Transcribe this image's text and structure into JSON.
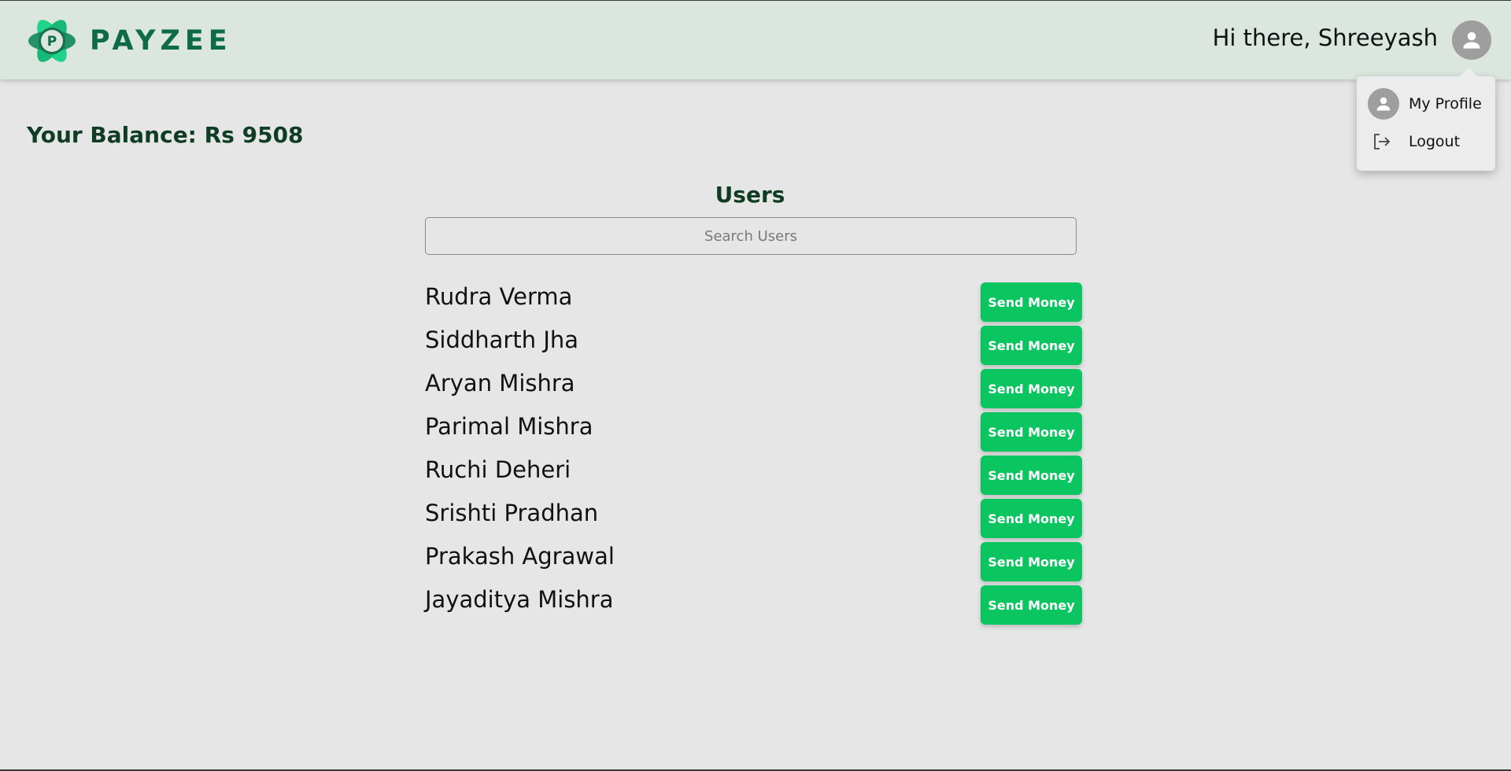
{
  "header": {
    "brand": "PAYZEE",
    "logo_letter": "P",
    "greeting": "Hi there, Shreeyash",
    "accent_color": "#0e6b4a"
  },
  "profile_menu": {
    "items": [
      {
        "label": "My Profile",
        "icon": "user-avatar-icon"
      },
      {
        "label": "Logout",
        "icon": "logout-icon"
      }
    ]
  },
  "balance": {
    "text": "Your Balance: Rs 9508"
  },
  "users": {
    "title": "Users",
    "search_placeholder": "Search Users",
    "send_button_color": "#0bc660",
    "list": [
      {
        "name": "Rudra Verma",
        "action": "Send Money"
      },
      {
        "name": "Siddharth Jha",
        "action": "Send Money"
      },
      {
        "name": "Aryan Mishra",
        "action": "Send Money"
      },
      {
        "name": "Parimal Mishra",
        "action": "Send Money"
      },
      {
        "name": "Ruchi Deheri",
        "action": "Send Money"
      },
      {
        "name": "Srishti Pradhan",
        "action": "Send Money"
      },
      {
        "name": "Prakash Agrawal",
        "action": "Send Money"
      },
      {
        "name": "Jayaditya Mishra",
        "action": "Send Money"
      }
    ]
  }
}
